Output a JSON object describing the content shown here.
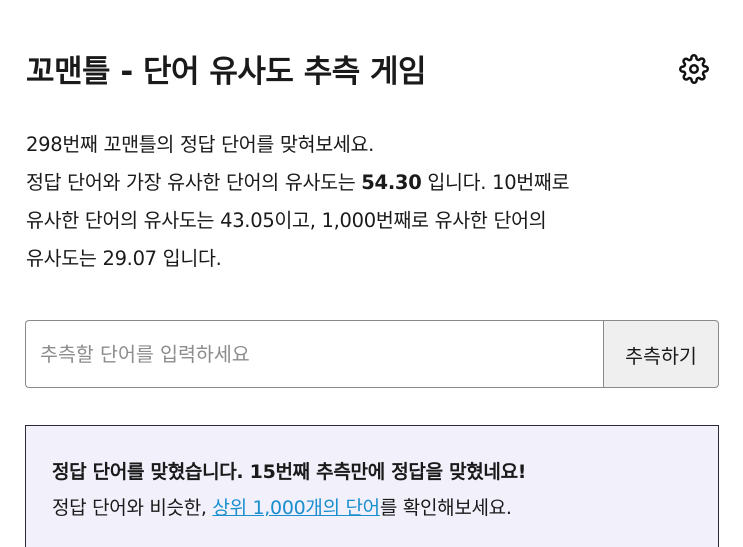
{
  "header": {
    "title": "꼬맨틀 - 단어 유사도 추측 게임",
    "settings_icon": "gear-icon"
  },
  "intro": {
    "line1": "298번째 꼬맨틀의 정답 단어를 맞혀보세요.",
    "line2_prefix": "정답 단어와 가장 유사한 단어의 유사도는 ",
    "line2_value": "54.30",
    "line2_suffix": " 입니다. 10번째로",
    "line3": "유사한 단어의 유사도는 43.05이고, 1,000번째로 유사한 단어의",
    "line4": "유사도는 29.07 입니다."
  },
  "guess": {
    "placeholder": "추측할 단어를 입력하세요",
    "value": "",
    "button_label": "추측하기"
  },
  "result": {
    "line1": "정답 단어를 맞혔습니다. 15번째 추측만에 정답을 맞혔네요!",
    "line2_prefix": "정답 단어와 비슷한, ",
    "line2_link": "상위 1,000개의 단어",
    "line2_suffix": "를 확인해보세요."
  },
  "colors": {
    "link": "#1a8fcf",
    "result_background": "#f1f0fb",
    "button_background": "#efefef"
  }
}
